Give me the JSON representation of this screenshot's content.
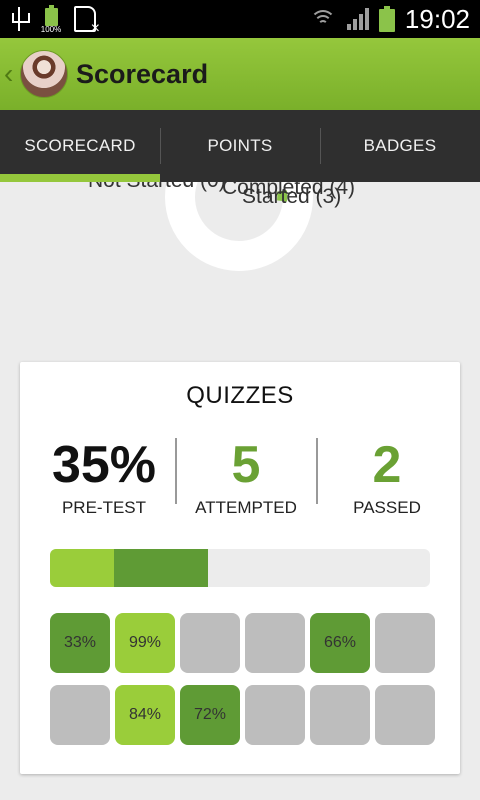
{
  "status_bar": {
    "time": "19:02",
    "battery_small_label": "100%"
  },
  "app_bar": {
    "title": "Scorecard"
  },
  "tabs": [
    {
      "label": "SCORECARD",
      "active": true
    },
    {
      "label": "POINTS",
      "active": false
    },
    {
      "label": "BADGES",
      "active": false
    }
  ],
  "donut": {
    "labels": [
      "Not Started (0)",
      "Started (3)",
      "Completed (4)"
    ]
  },
  "quizzes": {
    "title": "QUIZZES",
    "pretest": {
      "value": "35%",
      "label": "PRE-TEST"
    },
    "attempted": {
      "value": "5",
      "label": "ATTEMPTED"
    },
    "passed": {
      "value": "2",
      "label": "PASSED"
    },
    "progress": {
      "passed_fraction": 0.168,
      "attempted_fraction": 0.416
    },
    "cells": [
      {
        "text": "33%",
        "state": "fail"
      },
      {
        "text": "99%",
        "state": "pass"
      },
      {
        "text": "",
        "state": "none"
      },
      {
        "text": "",
        "state": "none"
      },
      {
        "text": "66%",
        "state": "fail"
      },
      {
        "text": "",
        "state": "none"
      },
      {
        "text": "",
        "state": "none"
      },
      {
        "text": "84%",
        "state": "pass"
      },
      {
        "text": "72%",
        "state": "fail"
      },
      {
        "text": "",
        "state": "none"
      },
      {
        "text": "",
        "state": "none"
      },
      {
        "text": "",
        "state": "none"
      }
    ]
  },
  "colors": {
    "accent_light": "#9acd3a",
    "accent_dark": "#5f9b35",
    "empty": "#bdbdbd"
  }
}
